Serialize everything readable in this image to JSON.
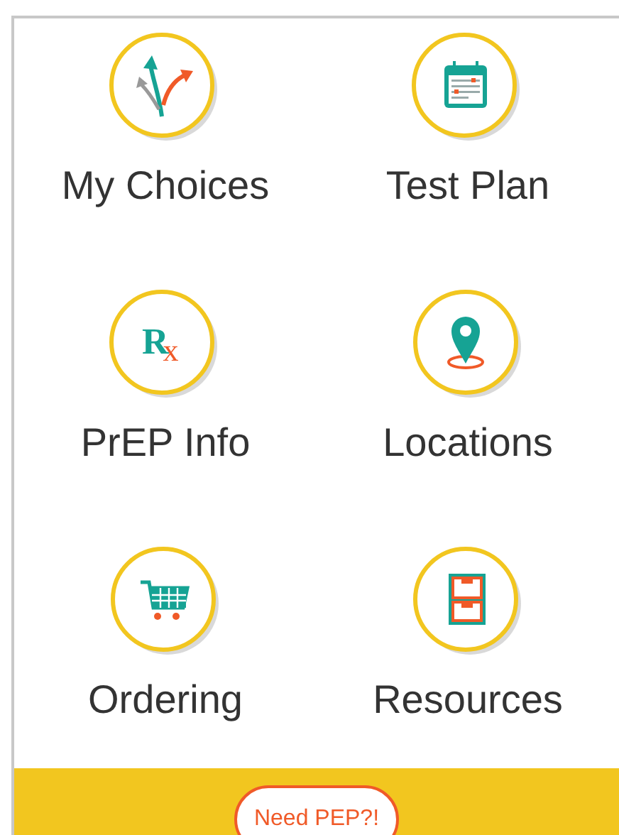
{
  "tiles": [
    {
      "kind": "choices",
      "label": "My Choices"
    },
    {
      "kind": "calendar",
      "label": "Test Plan"
    },
    {
      "kind": "rx",
      "label": "PrEP Info",
      "symbol": [
        "R",
        "x"
      ]
    },
    {
      "kind": "pin",
      "label": "Locations"
    },
    {
      "kind": "cart",
      "label": "Ordering"
    },
    {
      "kind": "cabinet",
      "label": "Resources"
    }
  ],
  "footer": {
    "button": "Need PEP?!"
  }
}
